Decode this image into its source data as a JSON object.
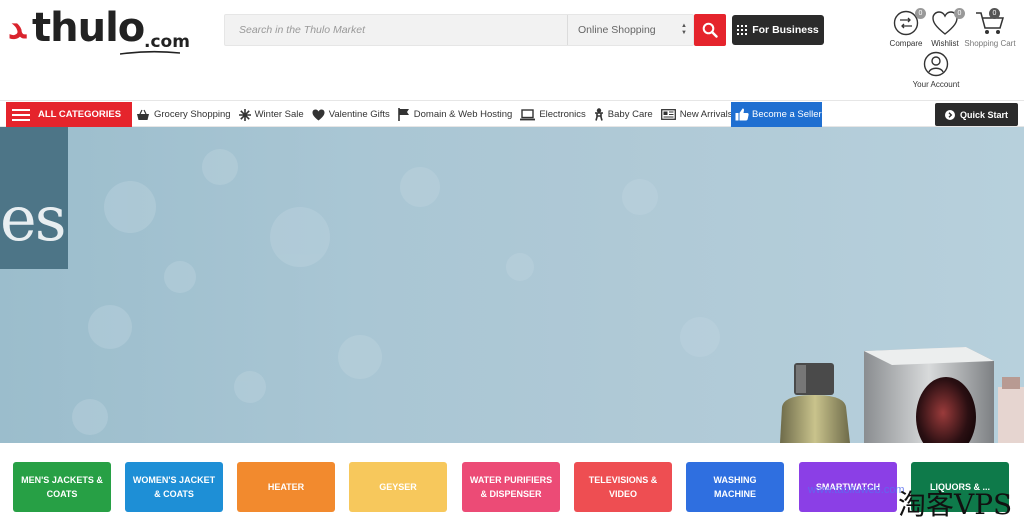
{
  "header": {
    "logo": {
      "text": "thulo",
      "suffix": ".com"
    },
    "search": {
      "placeholder": "Search in the Thulo Market",
      "category": "Online Shopping"
    },
    "business_label": "For Business",
    "compare": {
      "label": "Compare",
      "count": "0"
    },
    "wishlist": {
      "label": "Wishlist",
      "count": "0"
    },
    "cart": {
      "label": "Shopping Cart",
      "count": "0"
    },
    "account_label": "Your Account"
  },
  "nav": {
    "all_categories": "ALL CATEGORIES",
    "links": [
      {
        "label": "Grocery Shopping",
        "icon": "basket-icon"
      },
      {
        "label": "Winter Sale",
        "icon": "snowflake-icon"
      },
      {
        "label": "Valentine Gifts",
        "icon": "heart-icon"
      },
      {
        "label": "Domain & Web Hosting",
        "icon": "flag-icon"
      },
      {
        "label": "Electronics",
        "icon": "laptop-icon"
      },
      {
        "label": "Baby Care",
        "icon": "baby-icon"
      },
      {
        "label": "New Arrivals",
        "icon": "newspaper-icon"
      }
    ],
    "seller_label": "Become a Seller",
    "quick_start_label": "Quick Start"
  },
  "banner": {
    "letters": "es"
  },
  "tiles": [
    {
      "label": "MEN'S JACKETS & COATS",
      "color": "#27a045"
    },
    {
      "label": "WOMEN'S JACKET & COATS",
      "color": "#1e8fd6"
    },
    {
      "label": "HEATER",
      "color": "#f28a2e"
    },
    {
      "label": "GEYSER",
      "color": "#f7c85c"
    },
    {
      "label": "WATER PURIFIERS & DISPENSER",
      "color": "#ec4b76"
    },
    {
      "label": "TELEVISIONS & VIDEO",
      "color": "#ee4e52"
    },
    {
      "label": "WASHING MACHINE",
      "color": "#2f6fe0"
    },
    {
      "label": "SMARTWATCH",
      "color": "#8b3fe6"
    },
    {
      "label": "LIQUORS & ...",
      "color": "#0e7a4a"
    }
  ],
  "colors": {
    "brand_red": "#e5242c",
    "dark": "#2b2b2b",
    "seller_blue": "#1f6fd1"
  },
  "watermark": {
    "url": "www.taoliuweb.com",
    "text": "淘客VPS"
  }
}
